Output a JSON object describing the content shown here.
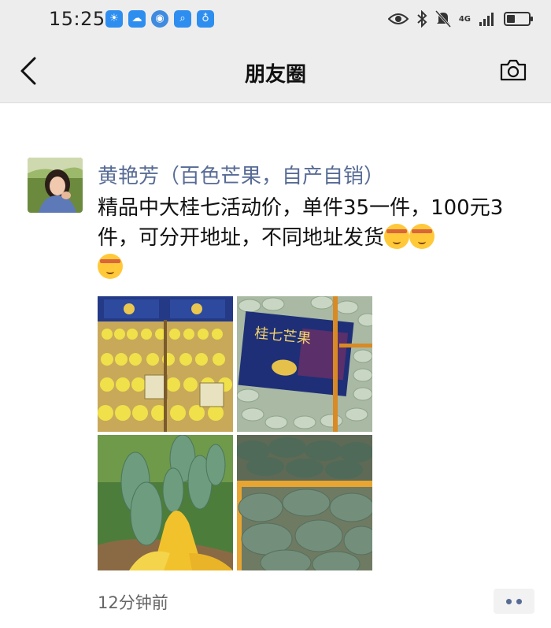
{
  "status_bar": {
    "time": "15:25",
    "network": "4G",
    "notification_icons": [
      "weather-icon",
      "cloud-icon",
      "browser-icon",
      "search-app-icon",
      "bulb-icon"
    ]
  },
  "nav": {
    "title": "朋友圈",
    "background": "#ededed"
  },
  "post": {
    "author": "黄艳芳（百色芒果，自产自销）",
    "text": "精品中大桂七活动价，单件35一件，100元3件，可分开地址，不同地址发货",
    "emojis": [
      "hushing-face-emoji",
      "hushing-face-emoji",
      "hushing-face-emoji"
    ],
    "box_label": "桂七芒果",
    "time_ago": "12分钟前",
    "name_color": "#576b95"
  }
}
